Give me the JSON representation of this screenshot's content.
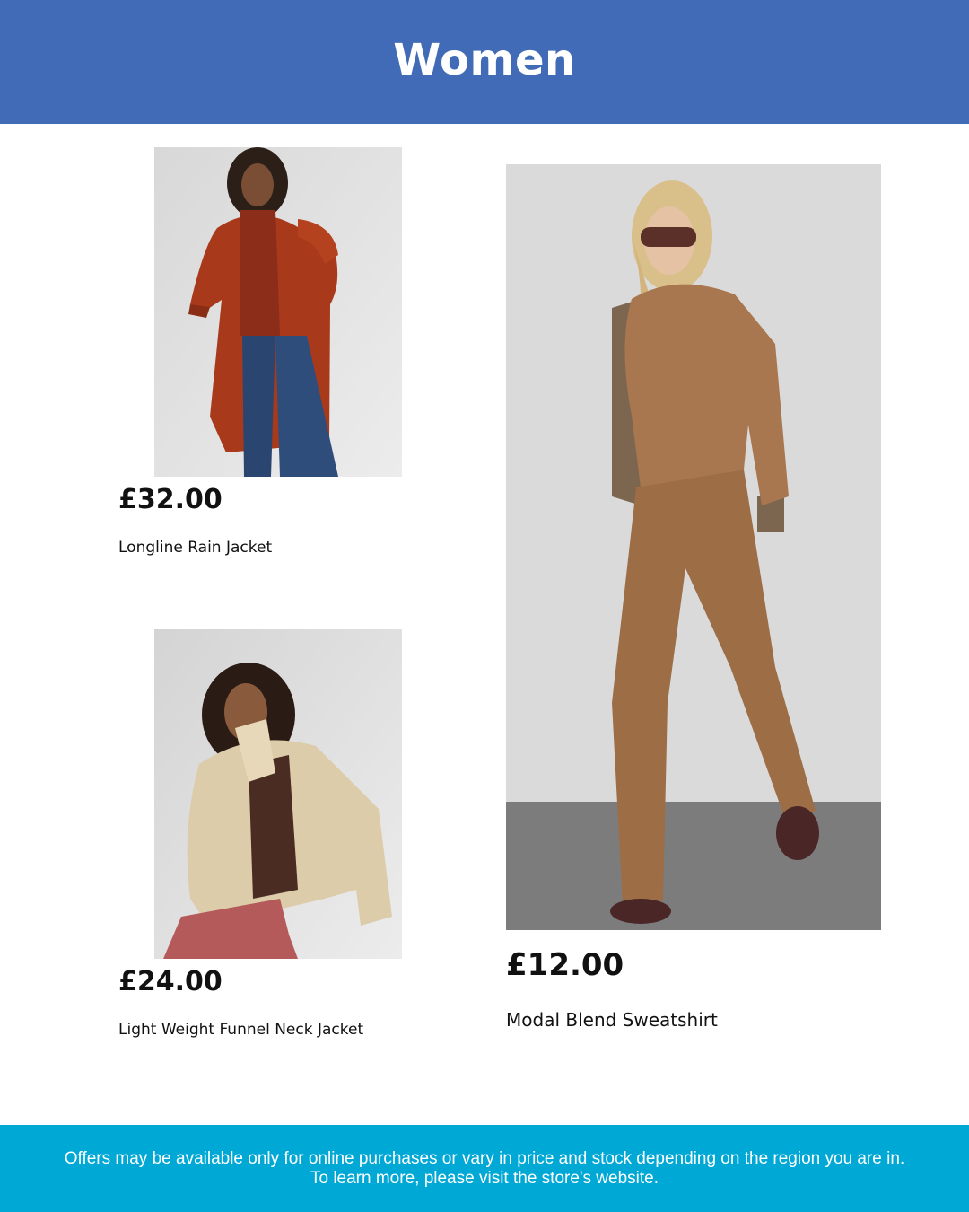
{
  "header": {
    "title": "Women"
  },
  "products": [
    {
      "price": "£32.00",
      "name": "Longline Rain Jacket",
      "image_alt": "woman in long rust-orange rain jacket"
    },
    {
      "price": "£24.00",
      "name": "Light Weight Funnel Neck Jacket",
      "image_alt": "woman in beige funnel neck jacket"
    },
    {
      "price": "£12.00",
      "name": "Modal Blend Sweatshirt",
      "image_alt": "woman in camel sweatshirt and wide trousers"
    }
  ],
  "footer": {
    "line1": "Offers may be available only for online purchases or vary in price and stock depending on the region you are in.",
    "line2": "To learn more, please visit the store's website."
  },
  "colors": {
    "header_bg": "#416bb6",
    "footer_bg": "#00a8d6"
  }
}
